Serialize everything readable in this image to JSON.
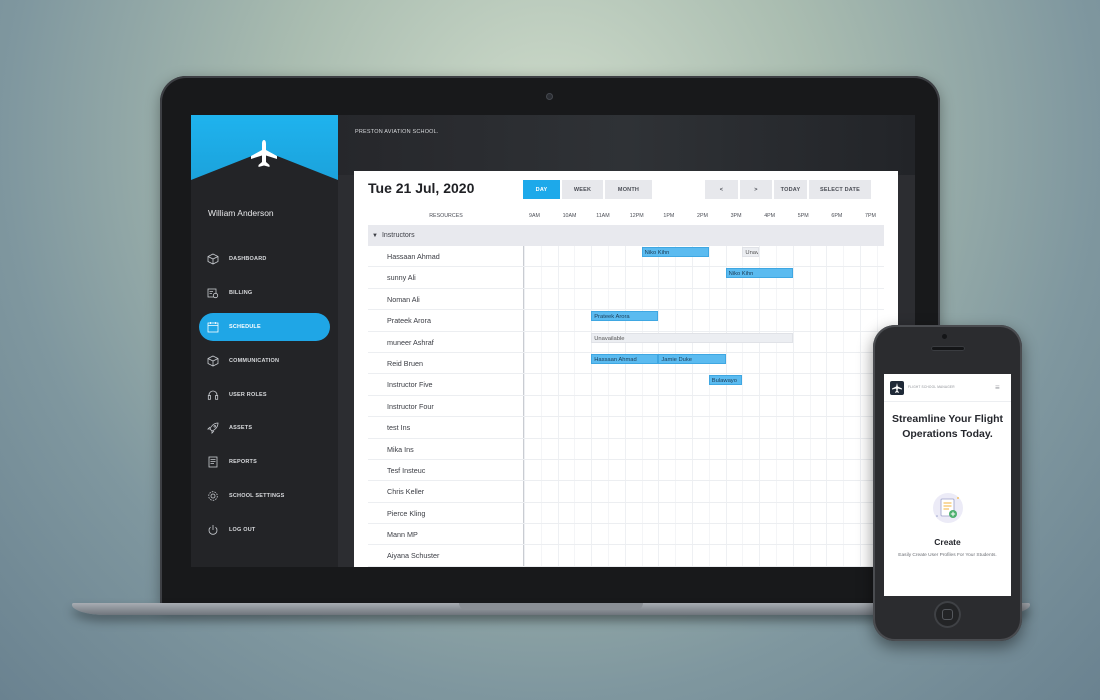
{
  "sidebar": {
    "user_name": "William Anderson",
    "items": [
      {
        "label": "DASHBOARD",
        "icon": "cube-icon"
      },
      {
        "label": "BILLING",
        "icon": "billing-icon"
      },
      {
        "label": "SCHEDULE",
        "icon": "calendar-icon",
        "active": true
      },
      {
        "label": "COMMUNICATION",
        "icon": "communication-icon"
      },
      {
        "label": "USER ROLES",
        "icon": "headset-icon"
      },
      {
        "label": "ASSETS",
        "icon": "rocket-icon"
      },
      {
        "label": "REPORTS",
        "icon": "report-icon"
      },
      {
        "label": "SCHOOL SETTINGS",
        "icon": "gear-icon"
      },
      {
        "label": "LOG OUT",
        "icon": "power-icon"
      }
    ]
  },
  "header": {
    "school_name": "PRESTON AVIATION SCHOOL."
  },
  "schedule": {
    "date_title": "Tue 21 Jul, 2020",
    "view_tabs": [
      "DAY",
      "WEEK",
      "MONTH"
    ],
    "active_view": "DAY",
    "nav": {
      "prev": "<",
      "next": ">",
      "today": "TODAY",
      "select_date": "SELECT DATE"
    },
    "resources_header": "RESOURCES",
    "times": [
      "9AM",
      "10AM",
      "11AM",
      "12PM",
      "1PM",
      "2PM",
      "3PM",
      "4PM",
      "5PM",
      "6PM",
      "7PM"
    ],
    "group": "Instructors",
    "rows": [
      {
        "name": "Hassaan Ahmad",
        "events": [
          {
            "label": "Niko Kihn",
            "start": 12.5,
            "end": 14.5,
            "type": "booking"
          },
          {
            "label": "Unav",
            "start": 15.5,
            "end": 16.0,
            "type": "unavailable"
          }
        ]
      },
      {
        "name": "sunny Ali",
        "events": [
          {
            "label": "Niko Kihn",
            "start": 15.0,
            "end": 17.0,
            "type": "booking"
          }
        ]
      },
      {
        "name": "Noman Ali",
        "events": []
      },
      {
        "name": "Prateek Arora",
        "events": [
          {
            "label": "Prateek Arora",
            "start": 11.0,
            "end": 13.0,
            "type": "booking"
          }
        ]
      },
      {
        "name": "muneer Ashraf",
        "events": [
          {
            "label": "Unavailable",
            "start": 11.0,
            "end": 17.0,
            "type": "unavailable"
          }
        ]
      },
      {
        "name": "Reid Bruen",
        "events": [
          {
            "label": "Hassaan Ahmad",
            "start": 11.0,
            "end": 13.0,
            "type": "booking"
          },
          {
            "label": "Jamie Duke",
            "start": 13.0,
            "end": 15.0,
            "type": "booking"
          }
        ]
      },
      {
        "name": "Instructor Five",
        "events": [
          {
            "label": "Bulawayo",
            "start": 14.5,
            "end": 15.5,
            "type": "booking"
          }
        ]
      },
      {
        "name": "Instructor Four",
        "events": []
      },
      {
        "name": "test Ins",
        "events": []
      },
      {
        "name": "Mika Ins",
        "events": []
      },
      {
        "name": "Tesf Insteuc",
        "events": []
      },
      {
        "name": "Chris Keller",
        "events": []
      },
      {
        "name": "Pierce Kling",
        "events": []
      },
      {
        "name": "Mann MP",
        "events": []
      },
      {
        "name": "Aiyana Schuster",
        "events": []
      }
    ]
  },
  "phone": {
    "brand": "FLIGHT SCHOOL MANAGER",
    "headline": "Streamline Your Flight Operations Today.",
    "feature_title": "Create",
    "feature_desc": "Easily Create User Profiles For Your Students.",
    "menu_icon": "hamburger-icon"
  },
  "colors": {
    "accent": "#1da9ea",
    "sidebar_bg": "#232427",
    "event": "#5bbbf0"
  }
}
